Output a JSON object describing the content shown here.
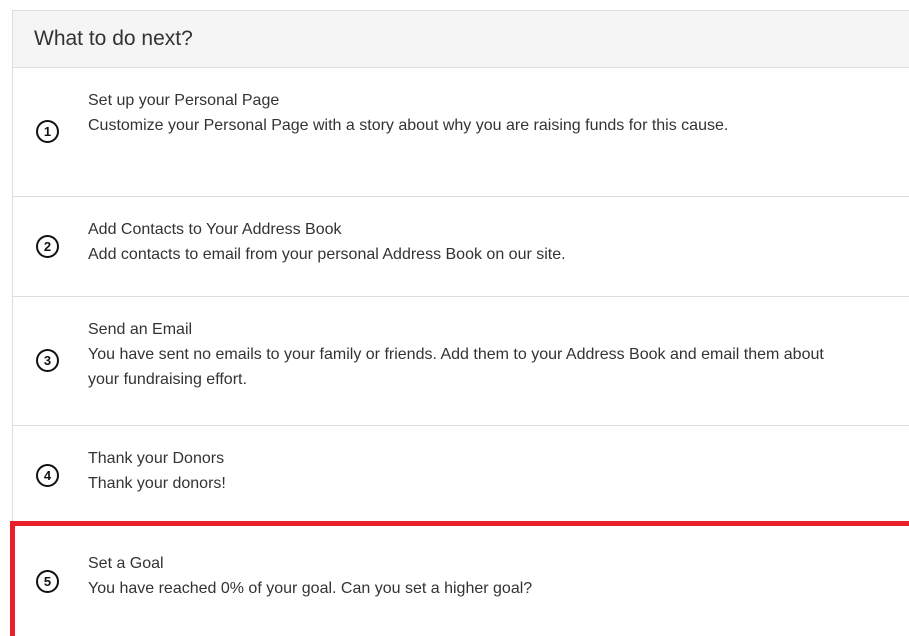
{
  "panel": {
    "title": "What to do next?"
  },
  "steps": [
    {
      "number": "1",
      "title": "Set up your Personal Page",
      "description": "Customize your Personal Page with a story about why you are raising funds for this cause."
    },
    {
      "number": "2",
      "title": "Add Contacts to Your Address Book",
      "description": "Add contacts to email from your personal Address Book on our site."
    },
    {
      "number": "3",
      "title": "Send an Email",
      "description": "You have sent no emails to your family or friends. Add them to your Address Book and email them about your fundraising effort."
    },
    {
      "number": "4",
      "title": "Thank your Donors",
      "description": "Thank your donors!"
    },
    {
      "number": "5",
      "title": "Set a Goal",
      "description": "You have reached 0% of your goal. Can you set a higher goal?"
    }
  ],
  "colors": {
    "highlight": "#e8202a",
    "header_bg": "#f5f5f5",
    "border": "#dddddd"
  }
}
